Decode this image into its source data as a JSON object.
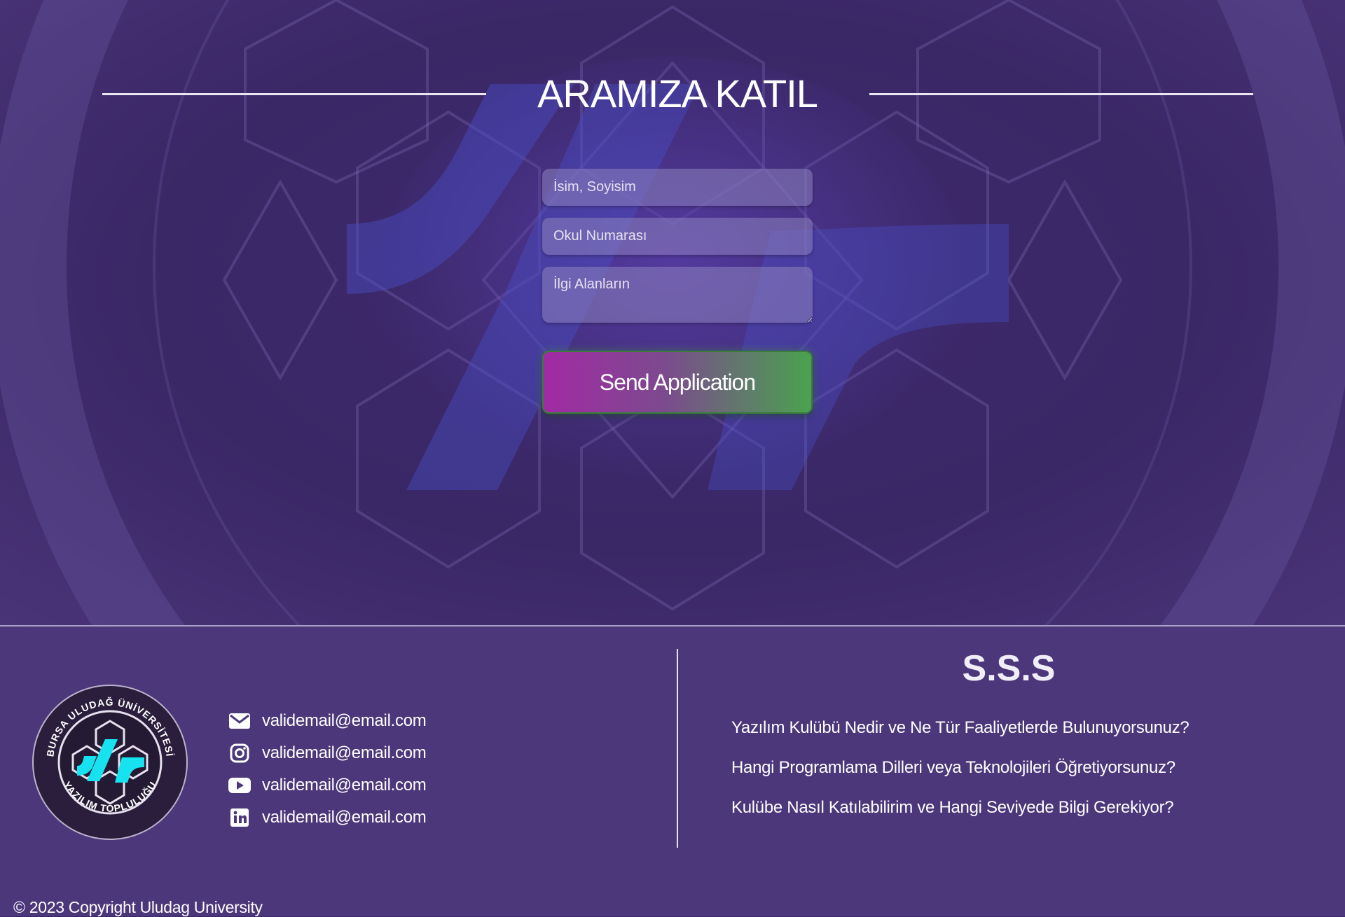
{
  "hero": {
    "title": "ARAMIZA KATIL"
  },
  "form": {
    "name_placeholder": "İsim, Soyisim",
    "number_placeholder": "Okul Numarası",
    "interests_placeholder": "İlgi Alanların",
    "submit_label": "Send Application"
  },
  "footer": {
    "logo": {
      "top_text": "BURSA ULUDAĞ ÜNİVERSİTESİ",
      "bottom_text": "YAZILIM TOPLULUĞU"
    },
    "contacts": [
      {
        "icon": "envelope-icon",
        "text": "validemail@email.com"
      },
      {
        "icon": "instagram-icon",
        "text": "validemail@email.com"
      },
      {
        "icon": "youtube-icon",
        "text": "validemail@email.com"
      },
      {
        "icon": "linkedin-icon",
        "text": "validemail@email.com"
      }
    ],
    "faq_title": "S.S.S",
    "faq": [
      "Yazılım Kulübü Nedir ve Ne Tür Faaliyetlerde Bulunuyorsunuz?",
      "Hangi Programlama Dilleri veya Teknolojileri Öğretiyorsunuz?",
      "Kulübe Nasıl Katılabilirim ve Hangi Seviyede Bilgi Gerekiyor?"
    ],
    "copyright": "© 2023 Copyright Uludag University"
  },
  "colors": {
    "background": "#3b2767",
    "footer": "#4c377a",
    "button_start": "#a22aa5",
    "button_end": "#4aa24f",
    "logo_accent": "#17e3f0"
  }
}
